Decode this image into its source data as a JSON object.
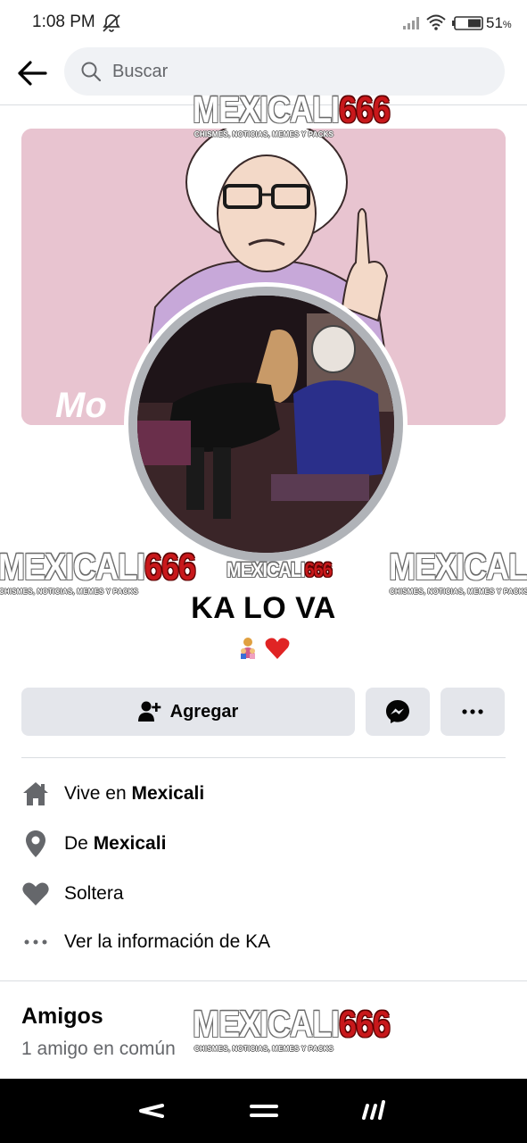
{
  "status_bar": {
    "time": "1:08 PM",
    "battery_percent": "51",
    "battery_unit": "%",
    "icons": [
      "mute-icon",
      "signal-icon",
      "wifi-icon",
      "battery-icon"
    ]
  },
  "top_nav": {
    "search_placeholder": "Buscar",
    "icons": [
      "back-arrow-icon",
      "search-icon"
    ]
  },
  "watermark": {
    "brand": "MEXICALI",
    "number": "666",
    "tagline": "CHISMES, NOTICIAS, MEMES Y PACKS"
  },
  "cover": {
    "caption": "Mo"
  },
  "profile": {
    "name": "KA LO VA",
    "bio_icons": [
      "family-emoji-icon",
      "red-heart-icon"
    ]
  },
  "actions": {
    "add_label": "Agregar",
    "icons": [
      "add-friend-icon",
      "messenger-icon",
      "more-dots-icon"
    ]
  },
  "info": {
    "lives_prefix": "Vive en ",
    "lives_city": "Mexicali",
    "from_prefix": "De ",
    "from_city": "Mexicali",
    "relationship": "Soltera",
    "see_info": "Ver la información de KA"
  },
  "friends": {
    "title": "Amigos",
    "mutual": "1 amigo en común"
  },
  "colors": {
    "button_bg": "#e4e6eb",
    "search_bg": "#f0f2f5",
    "secondary_text": "#65676b",
    "icon_gray": "#65676b",
    "watermark_red": "#c8181b",
    "cover_pink": "#e8c4d0"
  }
}
